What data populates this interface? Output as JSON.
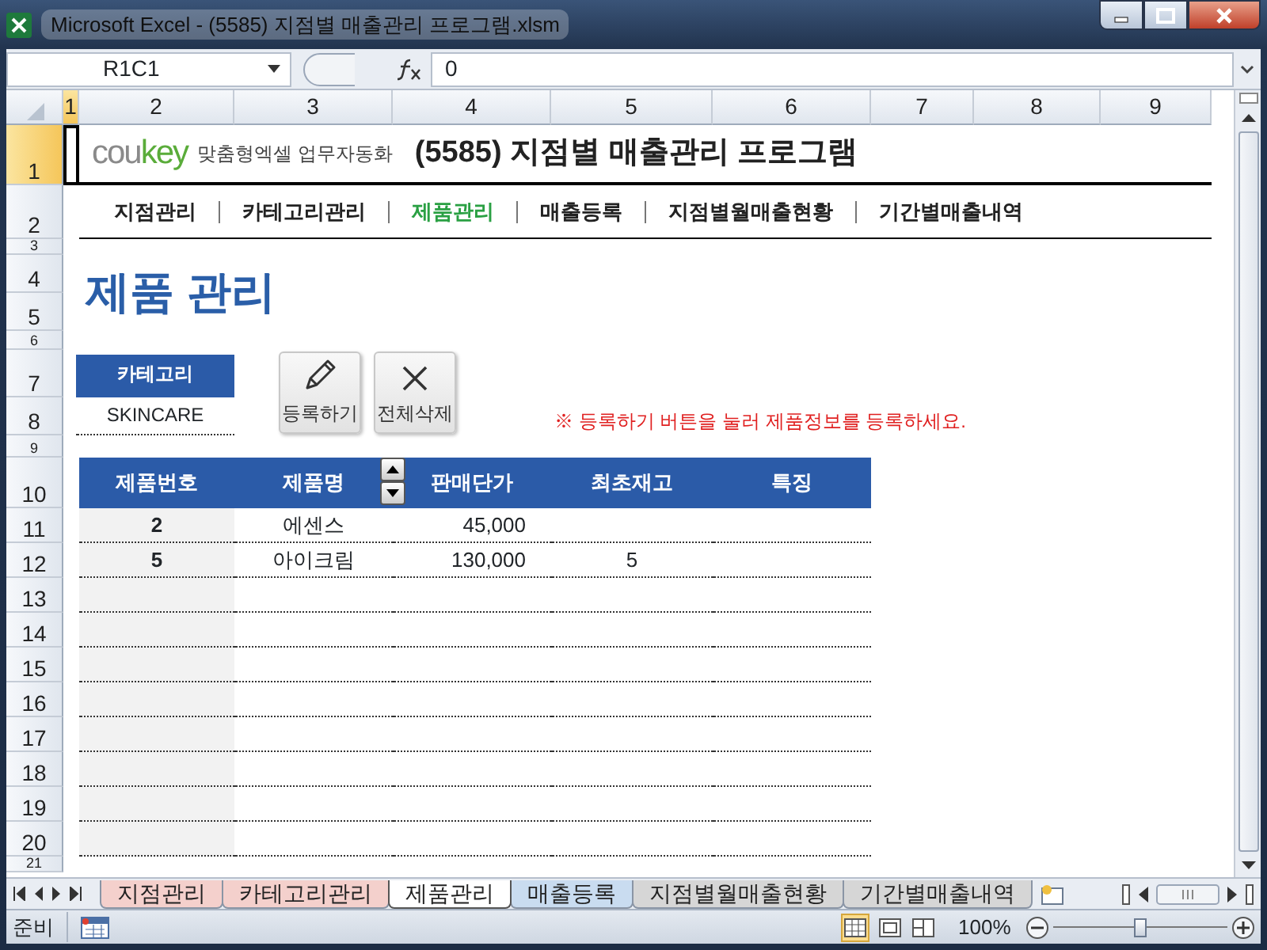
{
  "window": {
    "title": "Microsoft Excel - (5585) 지점별 매출관리 프로그램.xlsm"
  },
  "formula_bar": {
    "name_box": "R1C1",
    "value": "0"
  },
  "column_headers": [
    {
      "label": "1",
      "selected": true
    },
    {
      "label": "2",
      "selected": false
    },
    {
      "label": "3",
      "selected": false
    },
    {
      "label": "4",
      "selected": false
    },
    {
      "label": "5",
      "selected": false
    },
    {
      "label": "6",
      "selected": false
    },
    {
      "label": "7",
      "selected": false
    },
    {
      "label": "8",
      "selected": false
    },
    {
      "label": "9",
      "selected": false
    }
  ],
  "row_headers": [
    {
      "label": "1",
      "selected": true
    },
    {
      "label": "2",
      "selected": false
    },
    {
      "label": "3",
      "selected": false
    },
    {
      "label": "4",
      "selected": false
    },
    {
      "label": "5",
      "selected": false
    },
    {
      "label": "6",
      "selected": false
    },
    {
      "label": "7",
      "selected": false
    },
    {
      "label": "8",
      "selected": false
    },
    {
      "label": "9",
      "selected": false
    },
    {
      "label": "10",
      "selected": false
    },
    {
      "label": "11",
      "selected": false
    },
    {
      "label": "12",
      "selected": false
    },
    {
      "label": "13",
      "selected": false
    },
    {
      "label": "14",
      "selected": false
    },
    {
      "label": "15",
      "selected": false
    },
    {
      "label": "16",
      "selected": false
    },
    {
      "label": "17",
      "selected": false
    },
    {
      "label": "18",
      "selected": false
    },
    {
      "label": "19",
      "selected": false
    },
    {
      "label": "20",
      "selected": false
    },
    {
      "label": "21",
      "selected": false
    }
  ],
  "sheet": {
    "brand": [
      {
        "text": "cou",
        "color": "#8a8a8a"
      },
      {
        "text": "key",
        "color": "#5aac3a"
      }
    ],
    "tagline": "맞춤형엑셀 업무자동화",
    "title": "(5585) 지점별 매출관리 프로그램",
    "menu": [
      {
        "label": "지점관리",
        "selected": false
      },
      {
        "label": "카테고리관리",
        "selected": false
      },
      {
        "label": "제품관리",
        "selected": true
      },
      {
        "label": "매출등록",
        "selected": false
      },
      {
        "label": "지점별월매출현황",
        "selected": false
      },
      {
        "label": "기간별매출내역",
        "selected": false
      }
    ],
    "page_title": "제품 관리",
    "category": {
      "label": "카테고리",
      "value": "SKINCARE"
    },
    "buttons": [
      {
        "label": "등록하기",
        "kind": "edit"
      },
      {
        "label": "전체삭제",
        "kind": "delete"
      }
    ],
    "notice": "※ 등록하기 버튼을 눌러 제품정보를 등록하세요.",
    "table": {
      "columns": [
        "제품번호",
        "제품명",
        "판매단가",
        "최초재고",
        "특징"
      ],
      "rows": [
        {
          "product_no": "2",
          "name": "에센스",
          "price": "45,000"
        },
        {
          "product_no": "5",
          "name": "아이크림",
          "price": "130,000",
          "initial_stock": "5"
        }
      ]
    }
  },
  "sheet_tabs": [
    {
      "label": "지점관리",
      "selected": false,
      "color": "#f4d0cc"
    },
    {
      "label": "카테고리관리",
      "selected": false,
      "color": "#f4d0cc"
    },
    {
      "label": "제품관리",
      "selected": true,
      "color": "#ffffff"
    },
    {
      "label": "매출등록",
      "selected": false,
      "color": "#c9dcf0"
    },
    {
      "label": "지점별월매출현황",
      "selected": false,
      "color": "#d6d6d6"
    },
    {
      "label": "기간별매출내역",
      "selected": false,
      "color": "#d6d6d6"
    }
  ],
  "status_bar": {
    "mode": "준비",
    "zoom": "100%",
    "level": 0.5
  }
}
